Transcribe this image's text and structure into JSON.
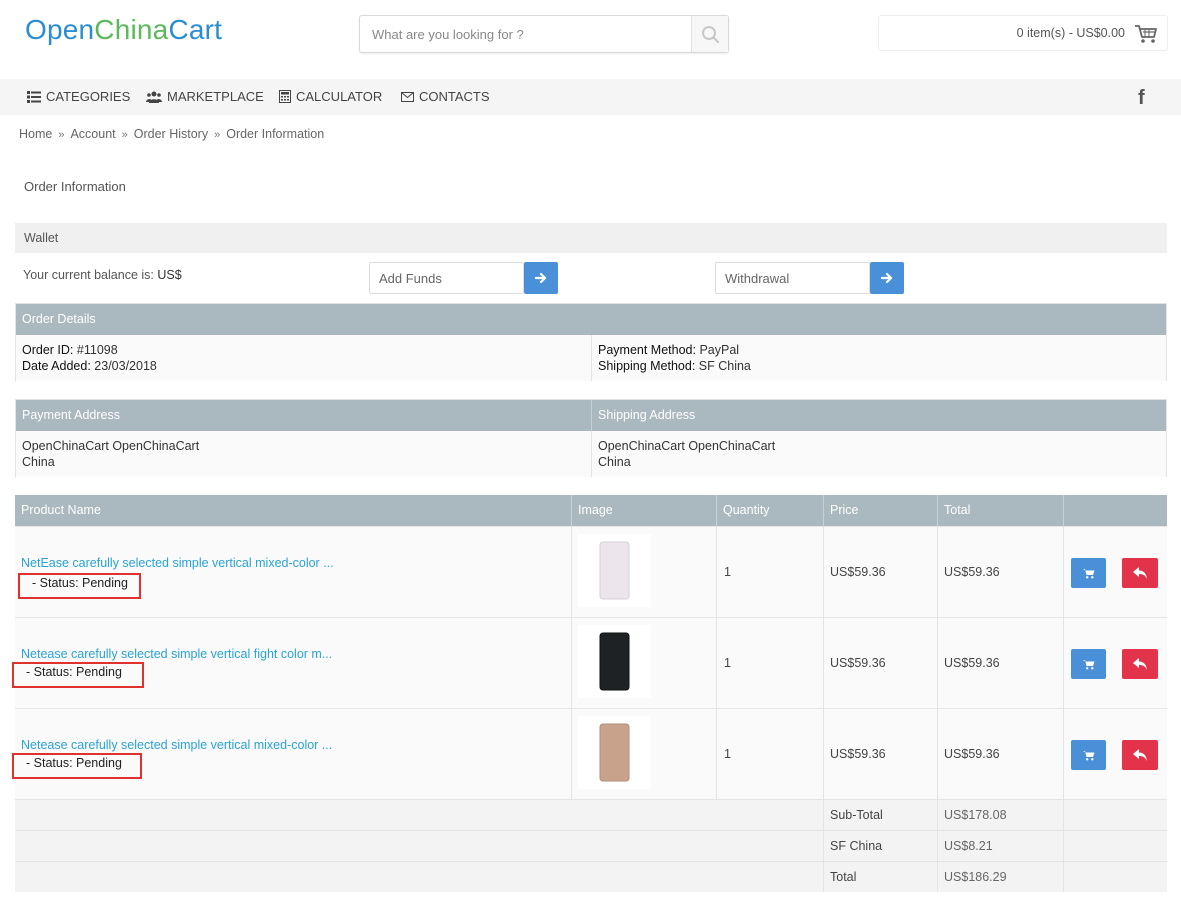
{
  "header": {
    "logo": {
      "part1": "Open",
      "part2": "China",
      "part3": "Cart"
    },
    "search_placeholder": "What are you looking for ?",
    "cart_summary": "0 item(s) - US$0.00"
  },
  "nav": {
    "categories": "CATEGORIES",
    "marketplace": "MARKETPLACE",
    "calculator": "CALCULATOR",
    "contacts": "CONTACTS",
    "facebook": "f"
  },
  "breadcrumb": [
    "Home",
    "Account",
    "Order History",
    "Order Information"
  ],
  "page_title": "Order Information",
  "wallet": {
    "heading": "Wallet",
    "balance_label": "Your current balance is:",
    "balance_value": "US$",
    "add_funds_placeholder": "Add Funds",
    "withdrawal_placeholder": "Withdrawal"
  },
  "order_details": {
    "heading": "Order Details",
    "order_id_label": "Order ID:",
    "order_id": "#11098",
    "date_label": "Date Added:",
    "date": "23/03/2018",
    "payment_method_label": "Payment Method:",
    "payment_method": "PayPal",
    "shipping_method_label": "Shipping Method:",
    "shipping_method": "SF China"
  },
  "addresses": {
    "payment_heading": "Payment Address",
    "shipping_heading": "Shipping Address",
    "payment_name": "OpenChinaCart OpenChinaCart",
    "payment_country": "China",
    "shipping_name": "OpenChinaCart OpenChinaCart",
    "shipping_country": "China"
  },
  "products": {
    "columns": [
      "Product Name",
      "Image",
      "Quantity",
      "Price",
      "Total"
    ],
    "rows": [
      {
        "name": "NetEase carefully selected simple vertical mixed-color ...",
        "status": " - Status: Pending",
        "quantity": "1",
        "price": "US$59.36",
        "total": "US$59.36",
        "color": "#ece6ec"
      },
      {
        "name": "Netease carefully selected simple vertical fight color m...",
        "status": " - Status: Pending",
        "quantity": "1",
        "price": "US$59.36",
        "total": "US$59.36",
        "color": "#1f2224"
      },
      {
        "name": "Netease carefully selected simple vertical mixed-color ...",
        "status": " - Status: Pending",
        "quantity": "1",
        "price": "US$59.36",
        "total": "US$59.36",
        "color": "#c9a28c"
      }
    ],
    "totals": [
      {
        "label": "Sub-Total",
        "value": "US$178.08"
      },
      {
        "label": "SF China",
        "value": "US$8.21"
      },
      {
        "label": "Total",
        "value": "US$186.29"
      }
    ]
  },
  "colors": {
    "accent_blue": "#4a90d9",
    "return_red": "#e3334a",
    "header_gray": "#aab8bf",
    "highlight_red": "#e0312e"
  }
}
